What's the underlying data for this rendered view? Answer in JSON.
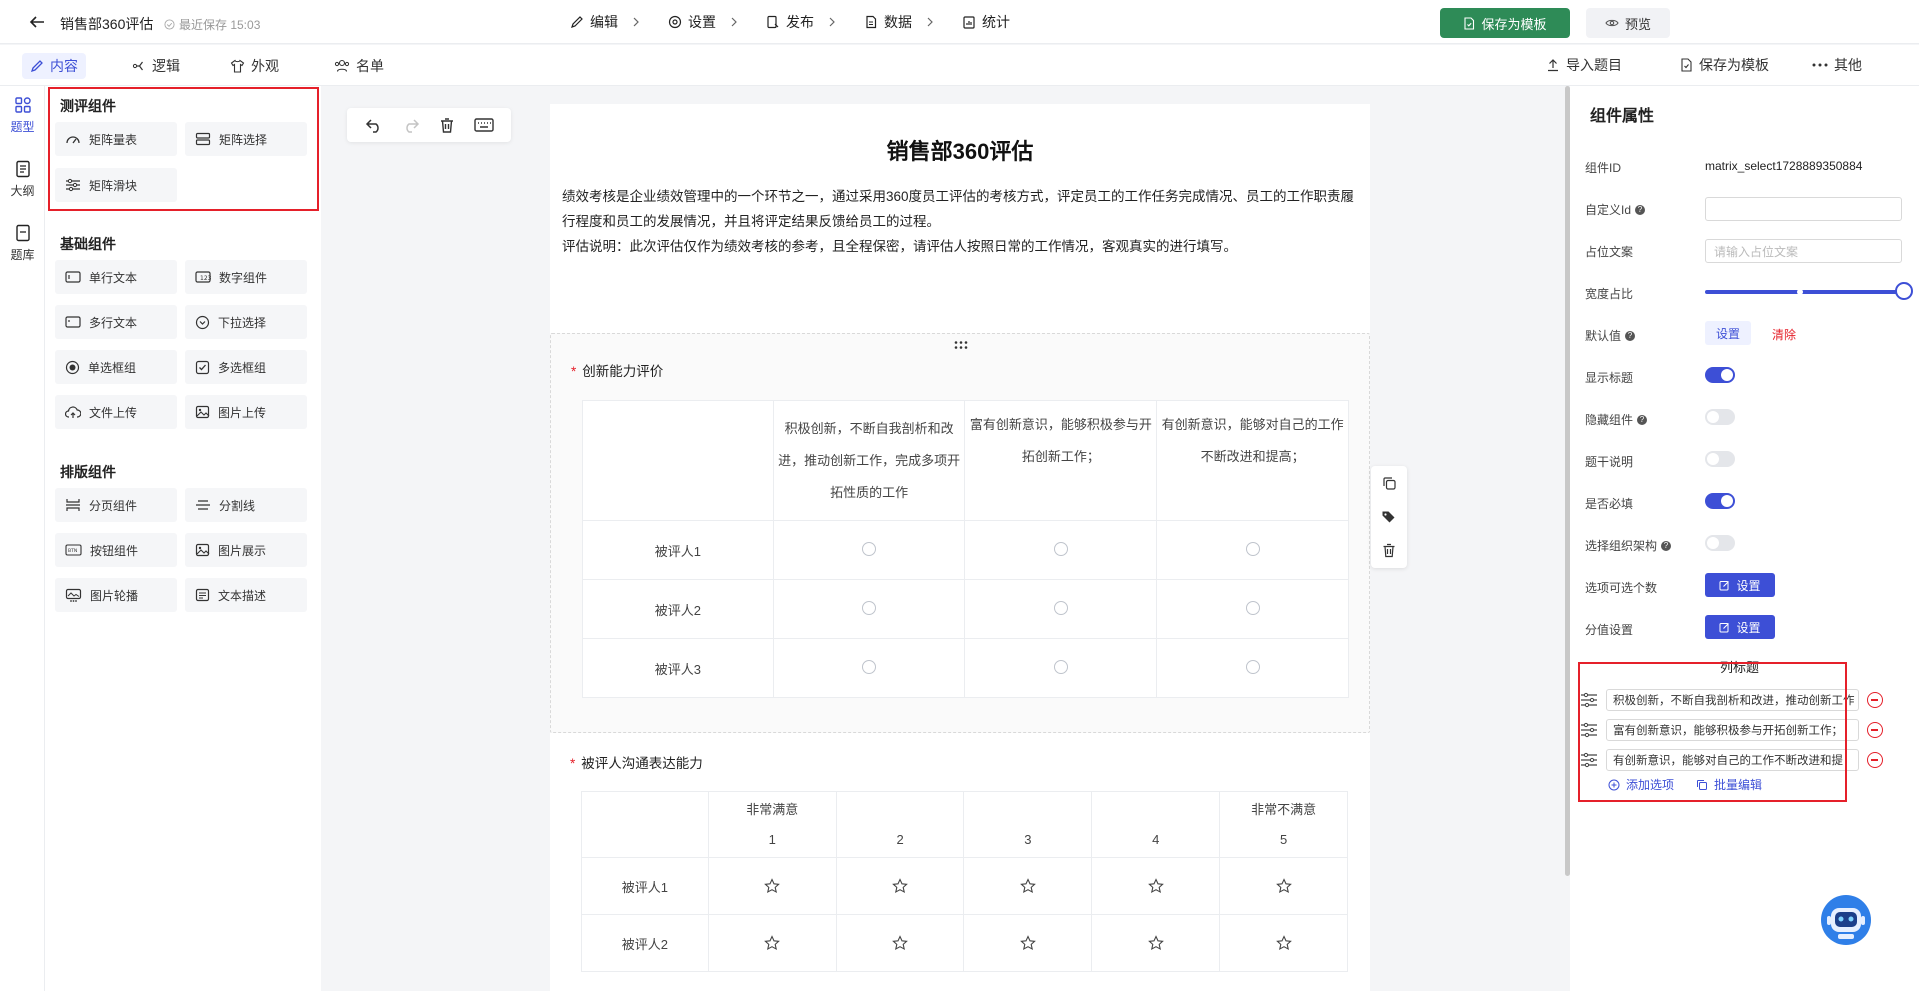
{
  "header": {
    "title": "销售部360评估",
    "save_hint": "最近保存 15:03",
    "steps": [
      {
        "label": "编辑"
      },
      {
        "label": "设置"
      },
      {
        "label": "发布"
      },
      {
        "label": "数据"
      },
      {
        "label": "统计"
      }
    ],
    "save_template": "保存为模板",
    "preview": "预览"
  },
  "subbar": {
    "tabs": [
      "内容",
      "逻辑",
      "外观",
      "名单"
    ],
    "import": "导入题目",
    "save_template": "保存为模板",
    "more": "其他"
  },
  "leftnav": [
    "题型",
    "大纲",
    "题库"
  ],
  "components": {
    "groups": [
      {
        "title": "测评组件",
        "items": [
          "矩阵量表",
          "矩阵选择",
          "矩阵滑块"
        ]
      },
      {
        "title": "基础组件",
        "items": [
          "单行文本",
          "数字组件",
          "多行文本",
          "下拉选择",
          "单选框组",
          "多选框组",
          "文件上传",
          "图片上传"
        ]
      },
      {
        "title": "排版组件",
        "items": [
          "分页组件",
          "分割线",
          "按钮组件",
          "图片展示",
          "图片轮播",
          "文本描述"
        ]
      }
    ]
  },
  "survey": {
    "title": "销售部360评估",
    "desc1": "绩效考核是企业绩效管理中的一个环节之一，通过采用360度员工评估的考核方式，评定员工的工作任务完成情况、员工的工作职责履行程度和员工的发展情况，并且将评定结果反馈给员工的过程。",
    "desc2": "评估说明：此次评估仅作为绩效考核的参考，且全程保密，请评估人按照日常的工作情况，客观真实的进行填写。",
    "q1": {
      "title": "创新能力评价",
      "columns": [
        "积极创新，不断自我剖析和改进，推动创新工作，完成多项开拓性质的工作",
        "富有创新意识，能够积极参与开拓创新工作；",
        "有创新意识，能够对自己的工作不断改进和提高；"
      ],
      "rows": [
        "被评人1",
        "被评人2",
        "被评人3"
      ]
    },
    "q2": {
      "title": "被评人沟通表达能力",
      "columns": [
        {
          "top": "非常满意",
          "num": "1"
        },
        {
          "top": "",
          "num": "2"
        },
        {
          "top": "",
          "num": "3"
        },
        {
          "top": "",
          "num": "4"
        },
        {
          "top": "非常不满意",
          "num": "5"
        }
      ],
      "rows": [
        "被评人1",
        "被评人2"
      ]
    }
  },
  "props": {
    "title": "组件属性",
    "id_label": "组件ID",
    "id_value": "matrix_select1728889350884",
    "custom_id_label": "自定义Id",
    "placeholder_label": "占位文案",
    "placeholder_hint": "请输入占位文案",
    "width_label": "宽度占比",
    "width_value": 1.0,
    "default_label": "默认值",
    "default_set": "设置",
    "default_clear": "清除",
    "show_title_label": "显示标题",
    "show_title": true,
    "hide_label": "隐藏组件",
    "hide": false,
    "stem_label": "题干说明",
    "stem": false,
    "required_label": "是否必填",
    "required": true,
    "org_label": "选择组织架构",
    "org": false,
    "options_count_label": "选项可选个数",
    "score_label": "分值设置",
    "set_btn": "设置",
    "col_title": "列标题",
    "col_items": [
      "积极创新，不断自我剖析和改进，推动创新工作",
      "富有创新意识，能够积极参与开拓创新工作；",
      "有创新意识，能够对自己的工作不断改进和提"
    ],
    "add_option": "添加选项",
    "batch_edit": "批量编辑"
  },
  "colors": {
    "accent": "#3d4fd6",
    "green": "#2e8b57",
    "danger": "#e5202a"
  }
}
